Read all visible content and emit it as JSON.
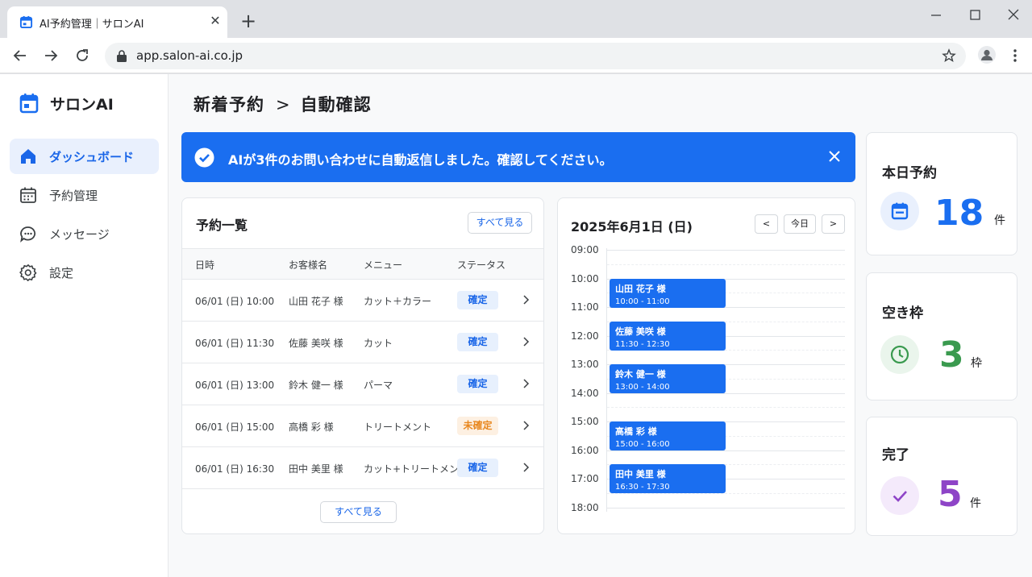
{
  "browser": {
    "tab_title": "AI予約管理｜サロンAI",
    "url": "app.salon-ai.co.jp"
  },
  "sidebar": {
    "brand": "サロンAI",
    "items": [
      {
        "label": "ダッシュボード",
        "icon": "home-icon",
        "active": true
      },
      {
        "label": "予約管理",
        "icon": "calendar-icon",
        "active": false
      },
      {
        "label": "メッセージ",
        "icon": "chat-icon",
        "active": false
      },
      {
        "label": "設定",
        "icon": "gear-icon",
        "active": false
      }
    ]
  },
  "header": {
    "crumb_parent": "新着予約",
    "crumb_separator": ">",
    "crumb_current": "自動確認"
  },
  "banner": {
    "text": "AIが3件のお問い合わせに自動返信しました。確認してください。",
    "color": "#1a6ef0"
  },
  "reservations": {
    "title": "予約一覧",
    "view_all_label": "すべて見る",
    "columns": [
      "日時",
      "お客様名",
      "メニュー",
      "ステータス"
    ],
    "rows": [
      {
        "datetime": "06/01 (日) 10:00",
        "customer": "山田 花子 様",
        "menu": "カット＋カラー",
        "status": "確定"
      },
      {
        "datetime": "06/01 (日) 11:30",
        "customer": "佐藤 美咲 様",
        "menu": "カット",
        "status": "確定"
      },
      {
        "datetime": "06/01 (日) 13:00",
        "customer": "鈴木 健一 様",
        "menu": "パーマ",
        "status": "確定"
      },
      {
        "datetime": "06/01 (日) 15:00",
        "customer": "高橋 彩 様",
        "menu": "トリートメント",
        "status": "未確定"
      },
      {
        "datetime": "06/01 (日) 16:30",
        "customer": "田中 美里 様",
        "menu": "カット+トリートメント",
        "status": "確定"
      }
    ]
  },
  "calendar": {
    "date": "2025年6月1日 (日)",
    "prev_label": "<",
    "today_label": "今日",
    "next_label": ">",
    "hours": [
      "09:00",
      "10:00",
      "11:00",
      "12:00",
      "13:00",
      "14:00",
      "15:00",
      "16:00",
      "17:00",
      "18:00"
    ],
    "events": [
      {
        "name": "山田 花子 様",
        "time": "10:00 - 11:00"
      },
      {
        "name": "佐藤 美咲 様",
        "time": "11:30 - 12:30"
      },
      {
        "name": "鈴木 健一 様",
        "time": "13:00 - 14:00"
      },
      {
        "name": "高橋 彩 様",
        "time": "15:00 - 16:00"
      },
      {
        "name": "田中 美里 様",
        "time": "16:30 - 17:30"
      }
    ]
  },
  "stats": [
    {
      "title": "本日予約",
      "value": "18",
      "unit": "件",
      "color": "#1a6ef0",
      "icon": "calendar-icon"
    },
    {
      "title": "空き枠",
      "value": "3",
      "unit": "枠",
      "color": "#3a9a4f",
      "icon": "clock-icon"
    },
    {
      "title": "完了",
      "value": "5",
      "unit": "件",
      "color": "#8e44c7",
      "icon": "check-icon"
    }
  ]
}
